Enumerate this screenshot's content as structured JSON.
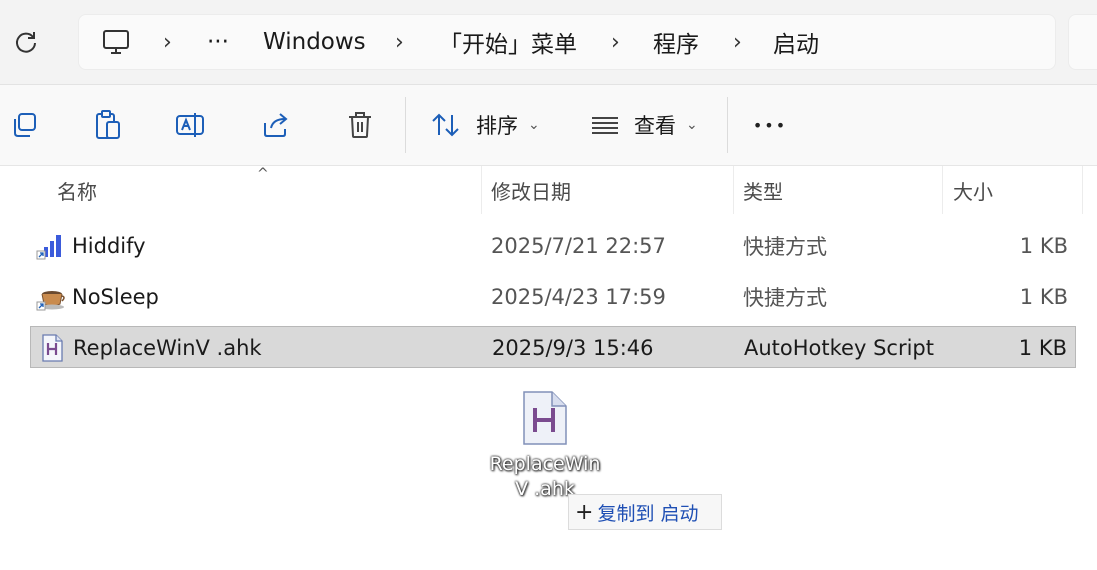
{
  "address_bar": {
    "crumbs": [
      "Windows",
      "「开始」菜单",
      "程序",
      "启动"
    ],
    "ellipsis": "···",
    "separator": "›"
  },
  "toolbar": {
    "sort_label": "排序",
    "view_label": "查看",
    "more_label": "•••",
    "chevron": "⌄"
  },
  "columns": {
    "name": "名称",
    "date": "修改日期",
    "type": "类型",
    "size": "大小",
    "sort_indicator": "^"
  },
  "files": [
    {
      "name": "Hiddify",
      "date": "2025/7/21 22:57",
      "type": "快捷方式",
      "size": "1 KB",
      "icon": "hiddify-shortcut-icon"
    },
    {
      "name": "NoSleep",
      "date": "2025/4/23 17:59",
      "type": "快捷方式",
      "size": "1 KB",
      "icon": "coffee-shortcut-icon"
    },
    {
      "name": "ReplaceWinV .ahk",
      "date": "2025/9/3 15:46",
      "type": "AutoHotkey Script",
      "size": "1 KB",
      "icon": "ahk-file-icon",
      "selected": true
    }
  ],
  "drag": {
    "label_line1": "ReplaceWin",
    "label_line2": "V .ahk",
    "tip_plus": "+",
    "tip_verb": "复制到",
    "tip_target": "启动"
  },
  "colors": {
    "selection_bg": "#d9d9d9",
    "accent_blue": "#1f4fb4"
  }
}
